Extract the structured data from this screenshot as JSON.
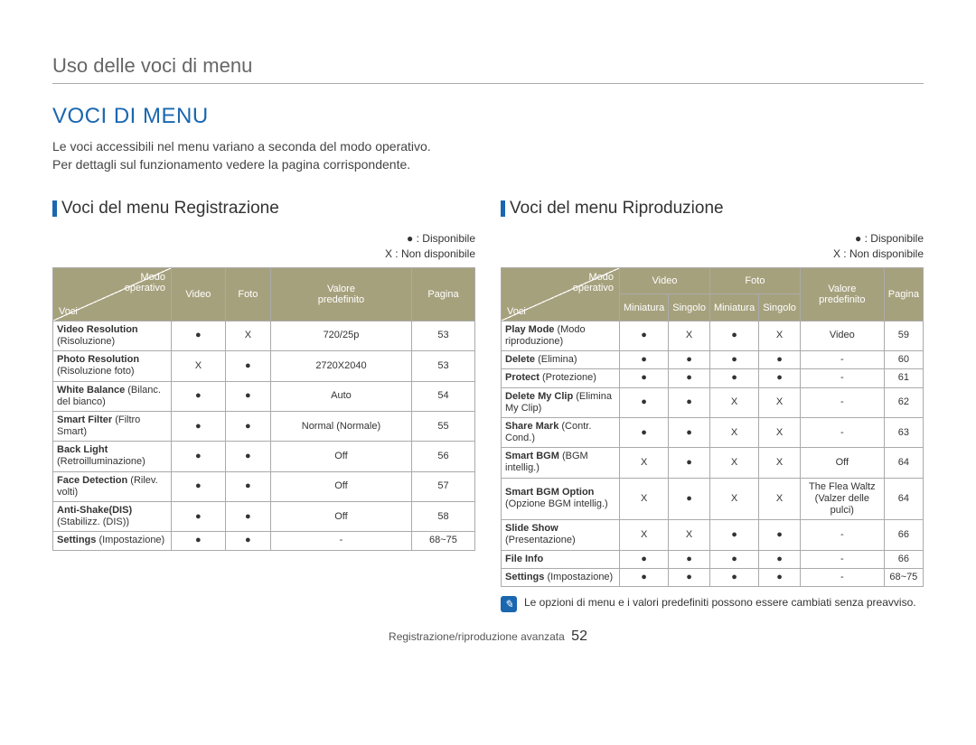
{
  "breadcrumb": "Uso delle voci di menu",
  "section_title": "VOCI DI MENU",
  "intro_line1": "Le voci accessibili nel menu variano a seconda del modo operativo.",
  "intro_line2": "Per dettagli sul funzionamento vedere la pagina corrispondente.",
  "legend_available": "● : Disponibile",
  "legend_unavailable": "X : Non disponibile",
  "left": {
    "title": "Voci del menu Registrazione",
    "corner_top": "Modo\noperativo",
    "corner_bottom": "Voci",
    "headers": [
      "Video",
      "Foto",
      "Valore\npredefinito",
      "Pagina"
    ],
    "rows": [
      {
        "label_bold": "Video Resolution",
        "label_sub": " (Risoluzione)",
        "c": [
          "●",
          "X",
          "720/25p",
          "53"
        ]
      },
      {
        "label_bold": "Photo Resolution",
        "label_sub": " (Risoluzione foto)",
        "c": [
          "X",
          "●",
          "2720X2040",
          "53"
        ]
      },
      {
        "label_bold": "White Balance",
        "label_sub": " (Bilanc. del bianco)",
        "c": [
          "●",
          "●",
          "Auto",
          "54"
        ]
      },
      {
        "label_bold": "Smart Filter",
        "label_sub": " (Filtro Smart)",
        "c": [
          "●",
          "●",
          "Normal (Normale)",
          "55"
        ]
      },
      {
        "label_bold": "Back Light",
        "label_sub": " (Retroilluminazione)",
        "c": [
          "●",
          "●",
          "Off",
          "56"
        ]
      },
      {
        "label_bold": "Face Detection",
        "label_sub": " (Rilev. volti)",
        "c": [
          "●",
          "●",
          "Off",
          "57"
        ]
      },
      {
        "label_bold": "Anti-Shake(DIS)",
        "label_sub": " (Stabilizz. (DIS))",
        "c": [
          "●",
          "●",
          "Off",
          "58"
        ]
      },
      {
        "label_bold": "Settings",
        "label_sub": " (Impostazione)",
        "c": [
          "●",
          "●",
          "-",
          "68~75"
        ]
      }
    ]
  },
  "right": {
    "title": "Voci del menu Riproduzione",
    "corner_top": "Modo\noperativo",
    "corner_bottom": "Voci",
    "group_headers": [
      "Video",
      "Foto"
    ],
    "sub_headers": [
      "Miniatura",
      "Singolo",
      "Miniatura",
      "Singolo"
    ],
    "trailing_headers": [
      "Valore\npredefinito",
      "Pagina"
    ],
    "rows": [
      {
        "label_bold": "Play Mode",
        "label_sub": " (Modo riproduzione)",
        "c": [
          "●",
          "X",
          "●",
          "X",
          "Video",
          "59"
        ]
      },
      {
        "label_bold": "Delete",
        "label_sub": " (Elimina)",
        "c": [
          "●",
          "●",
          "●",
          "●",
          "-",
          "60"
        ]
      },
      {
        "label_bold": "Protect",
        "label_sub": " (Protezione)",
        "c": [
          "●",
          "●",
          "●",
          "●",
          "-",
          "61"
        ]
      },
      {
        "label_bold": "Delete My Clip",
        "label_sub": " (Elimina My Clip)",
        "c": [
          "●",
          "●",
          "X",
          "X",
          "-",
          "62"
        ]
      },
      {
        "label_bold": "Share Mark",
        "label_sub": " (Contr. Cond.)",
        "c": [
          "●",
          "●",
          "X",
          "X",
          "-",
          "63"
        ]
      },
      {
        "label_bold": "Smart BGM",
        "label_sub": " (BGM intellig.)",
        "c": [
          "X",
          "●",
          "X",
          "X",
          "Off",
          "64"
        ]
      },
      {
        "label_bold": "Smart BGM Option",
        "label_sub": " (Opzione BGM intellig.)",
        "c": [
          "X",
          "●",
          "X",
          "X",
          "The Flea Waltz (Valzer delle pulci)",
          "64"
        ]
      },
      {
        "label_bold": "Slide Show",
        "label_sub": " (Presentazione)",
        "c": [
          "X",
          "X",
          "●",
          "●",
          "-",
          "66"
        ]
      },
      {
        "label_bold": "File Info",
        "label_sub": "",
        "c": [
          "●",
          "●",
          "●",
          "●",
          "-",
          "66"
        ]
      },
      {
        "label_bold": "Settings",
        "label_sub": " (Impostazione)",
        "c": [
          "●",
          "●",
          "●",
          "●",
          "-",
          "68~75"
        ]
      }
    ]
  },
  "note": "Le opzioni di menu e i valori predefiniti possono essere cambiati senza preavviso.",
  "footer_text": "Registrazione/riproduzione avanzata",
  "footer_page": "52"
}
